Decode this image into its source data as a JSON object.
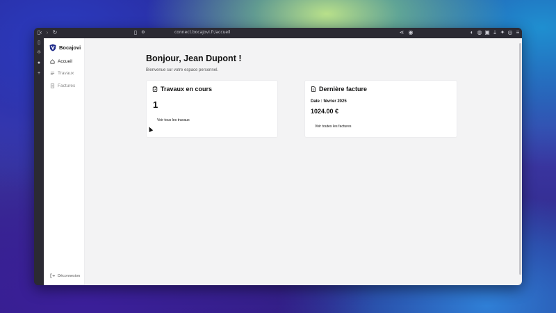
{
  "browser": {
    "url": "connect.bocajovi.fr/accueil"
  },
  "app": {
    "brand": "Bocajovi",
    "nav": [
      {
        "label": "Accueil",
        "active": true
      },
      {
        "label": "Travaux",
        "active": false
      },
      {
        "label": "Factures",
        "active": false
      }
    ],
    "logout": "Déconnexion"
  },
  "main": {
    "greeting": "Bonjour, Jean Dupont !",
    "subtitle": "Bienvenue sur votre espace personnel.",
    "works_card": {
      "title": "Travaux en cours",
      "count": "1",
      "link": "Voir tous les travaux"
    },
    "invoice_card": {
      "title": "Dernière facture",
      "date": "Date : février 2025",
      "amount": "1024.00 €",
      "link": "Voir toutes les factures"
    }
  },
  "colors": {
    "accent": "#1e2a8a",
    "page_bg": "#f3f3f4",
    "card_bg": "#ffffff"
  },
  "icons": [
    "sidebar-icon",
    "back-icon",
    "forward-icon",
    "reload-icon",
    "bookmark-icon",
    "share-icon",
    "shield-icon",
    "download-icon",
    "extensions-icon",
    "menu-icon",
    "home-icon",
    "list-icon",
    "invoice-icon",
    "clipboard-icon",
    "document-icon",
    "logout-icon"
  ]
}
